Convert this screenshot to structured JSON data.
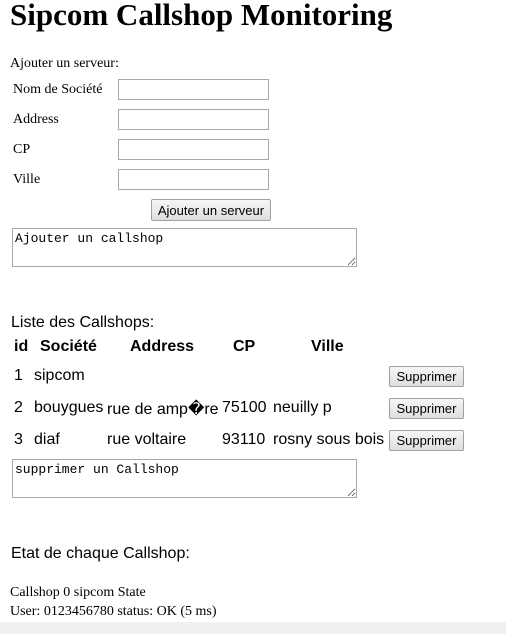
{
  "title": "Sipcom Callshop Monitoring",
  "add_form": {
    "heading": "Ajouter un serveur:",
    "labels": {
      "societe": "Nom de Société",
      "address": "Address",
      "cp": "CP",
      "ville": "Ville"
    },
    "submit": "Ajouter un serveur",
    "log": "Ajouter un callshop"
  },
  "list": {
    "heading": "Liste des Callshops:",
    "columns": [
      "id",
      "Société",
      "Address",
      "CP",
      "Ville"
    ],
    "rows": [
      {
        "id": "1",
        "societe": "sipcom",
        "address": "",
        "cp": "",
        "ville": ""
      },
      {
        "id": "2",
        "societe": "bouygues",
        "address": "rue de amp�re",
        "cp": "75100",
        "ville": "neuilly p"
      },
      {
        "id": "3",
        "societe": "diaf",
        "address": "rue voltaire",
        "cp": "93110",
        "ville": "rosny sous bois"
      }
    ],
    "delete_label": "Supprimer",
    "log": "supprimer un Callshop"
  },
  "state": {
    "heading": "Etat de chaque Callshop:",
    "line1": "Callshop 0 sipcom State",
    "line2": "User: 0123456780 status: OK (5 ms)"
  }
}
